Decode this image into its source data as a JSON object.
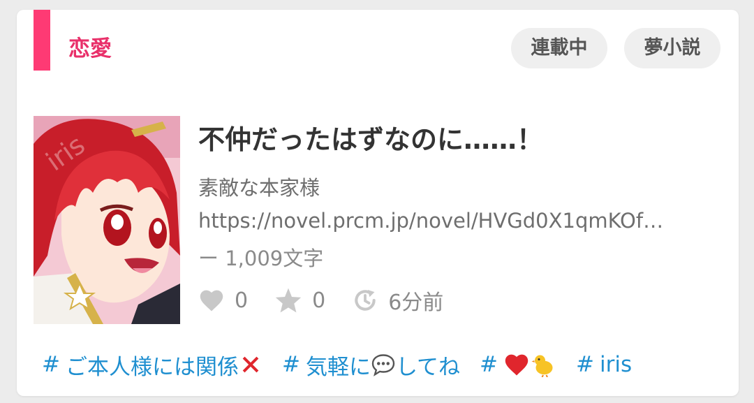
{
  "card": {
    "genre": "恋愛",
    "badges": [
      "連載中",
      "夢小説"
    ],
    "title": "不仲だったはずなのに……！",
    "author": "素敵な本家様",
    "url": "https://novel.prcm.jp/novel/HVGd0X1qmKOf…",
    "word_count": "ー 1,009文字",
    "likes": "0",
    "stars": "0",
    "updated": "6分前",
    "tags": [
      {
        "hash": "#",
        "text": "ご本人様には関係",
        "emoji": "cross-mark-icon"
      },
      {
        "hash": "#",
        "text_before": "気軽に",
        "emoji": "speech-balloon-icon",
        "text_after": "してね"
      },
      {
        "hash": "#",
        "emoji_1": "red-heart-icon",
        "emoji_2": "chick-icon"
      },
      {
        "hash": "#",
        "text": "iris"
      }
    ]
  },
  "colors": {
    "accent": "#fe3a74",
    "genre_text": "#e9306a",
    "tag_link": "#1f8fd0",
    "badge_bg": "#efefef"
  }
}
